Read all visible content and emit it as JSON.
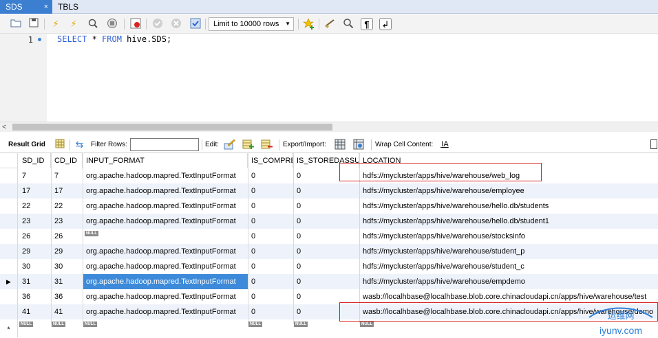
{
  "tabs": [
    {
      "label": "SDS",
      "close": "×"
    },
    {
      "label": "TBLS"
    }
  ],
  "toolbar": {
    "limit_label": "Limit to 10000 rows"
  },
  "editor": {
    "line_number": "1",
    "code_kw1": "SELECT",
    "code_mid": " * ",
    "code_kw2": "FROM",
    "code_rest": " hive.SDS;"
  },
  "result_toolbar": {
    "result_grid": "Result Grid",
    "filter_rows": "Filter Rows:",
    "edit": "Edit:",
    "export_import": "Export/Import:",
    "wrap_cell": "Wrap Cell Content:"
  },
  "grid": {
    "columns": [
      "SD_ID",
      "CD_ID",
      "INPUT_FORMAT",
      "IS_COMPRE",
      "IS_STOREDASSUB",
      "LOCATION"
    ],
    "null_label": "NULL",
    "rows": [
      {
        "sd": "7",
        "cd": "7",
        "fmt": "org.apache.hadoop.mapred.TextInputFormat",
        "comp": "0",
        "sub": "0",
        "loc": "hdfs://mycluster/apps/hive/warehouse/web_log"
      },
      {
        "sd": "17",
        "cd": "17",
        "fmt": "org.apache.hadoop.mapred.TextInputFormat",
        "comp": "0",
        "sub": "0",
        "loc": "hdfs://mycluster/apps/hive/warehouse/employee"
      },
      {
        "sd": "22",
        "cd": "22",
        "fmt": "org.apache.hadoop.mapred.TextInputFormat",
        "comp": "0",
        "sub": "0",
        "loc": "hdfs://mycluster/apps/hive/warehouse/hello.db/students"
      },
      {
        "sd": "23",
        "cd": "23",
        "fmt": "org.apache.hadoop.mapred.TextInputFormat",
        "comp": "0",
        "sub": "0",
        "loc": "hdfs://mycluster/apps/hive/warehouse/hello.db/student1"
      },
      {
        "sd": "26",
        "cd": "26",
        "fmt": "NULL",
        "comp": "0",
        "sub": "0",
        "loc": "hdfs://mycluster/apps/hive/warehouse/stocksinfo"
      },
      {
        "sd": "29",
        "cd": "29",
        "fmt": "org.apache.hadoop.mapred.TextInputFormat",
        "comp": "0",
        "sub": "0",
        "loc": "hdfs://mycluster/apps/hive/warehouse/student_p"
      },
      {
        "sd": "30",
        "cd": "30",
        "fmt": "org.apache.hadoop.mapred.TextInputFormat",
        "comp": "0",
        "sub": "0",
        "loc": "hdfs://mycluster/apps/hive/warehouse/student_c"
      },
      {
        "sd": "31",
        "cd": "31",
        "fmt": "org.apache.hadoop.mapred.TextInputFormat",
        "comp": "0",
        "sub": "0",
        "loc": "hdfs://mycluster/apps/hive/warehouse/empdemo"
      },
      {
        "sd": "36",
        "cd": "36",
        "fmt": "org.apache.hadoop.mapred.TextInputFormat",
        "comp": "0",
        "sub": "0",
        "loc": "wasb://localhbase@localhbase.blob.core.chinacloudapi.cn/apps/hive/warehouse/test"
      },
      {
        "sd": "41",
        "cd": "41",
        "fmt": "org.apache.hadoop.mapred.TextInputFormat",
        "comp": "0",
        "sub": "0",
        "loc": "wasb://localhbase@localhbase.blob.core.chinacloudapi.cn/apps/hive/warehouse/demo"
      }
    ],
    "selected_row_marker": "▶",
    "new_row_marker": "*"
  },
  "watermark": {
    "top_text": "运维网",
    "bottom_text": "iyunv.com"
  },
  "colors": {
    "tab_active": "#3c7fd1",
    "selection": "#3c8ad9",
    "sql_keyword": "#2f61d9",
    "highlight_box": "#d32020"
  }
}
